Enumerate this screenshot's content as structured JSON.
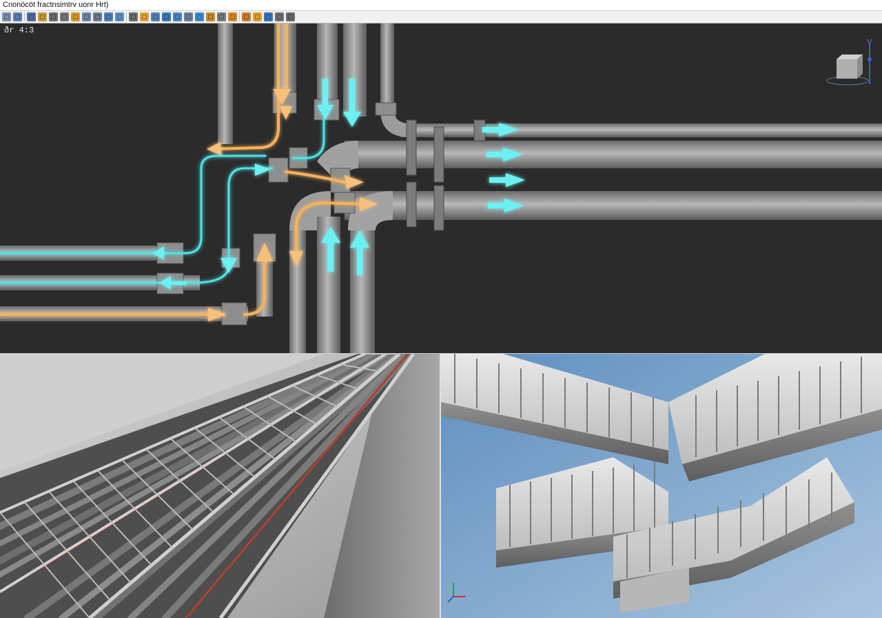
{
  "window": {
    "title": "Cnonócöt fractnsimtrv uonr Hrt)"
  },
  "toolbar": {
    "icons": [
      {
        "name": "frame-icon",
        "color": "#7a8fb0"
      },
      {
        "name": "grid-icon",
        "color": "#5a7fb5"
      },
      {
        "name": "layers-icon",
        "color": "#4d6e9e"
      },
      {
        "name": "cube-icon",
        "color": "#c99a3b"
      },
      {
        "name": "panel-icon",
        "color": "#6d6d6d"
      },
      {
        "name": "loop-icon",
        "color": "#777777"
      },
      {
        "name": "folder-icon",
        "color": "#d6962f"
      },
      {
        "name": "table-icon",
        "color": "#6d86a8"
      },
      {
        "name": "split-icon",
        "color": "#6b7c94"
      },
      {
        "name": "pipe-icon",
        "color": "#4f7fb9"
      },
      {
        "name": "duct-icon",
        "color": "#5d8fc4"
      },
      {
        "name": "tray-icon",
        "color": "#6c6c6c"
      },
      {
        "name": "valve-icon",
        "color": "#e0a33a"
      },
      {
        "name": "fitting-icon",
        "color": "#5580b8"
      },
      {
        "name": "elbow-icon",
        "color": "#3c76b5"
      },
      {
        "name": "tee-icon",
        "color": "#4a84c2"
      },
      {
        "name": "flange-icon",
        "color": "#6e7f94"
      },
      {
        "name": "flow-icon",
        "color": "#3d8fd0"
      },
      {
        "name": "measure-icon",
        "color": "#c68a2a"
      },
      {
        "name": "section-icon",
        "color": "#7a7a7a"
      },
      {
        "name": "render-icon",
        "color": "#d28c2c"
      },
      {
        "name": "tag-icon",
        "color": "#d07a2e"
      },
      {
        "name": "paint-icon",
        "color": "#e0a02f"
      },
      {
        "name": "visibility-icon",
        "color": "#3a74b8"
      },
      {
        "name": "calc-icon",
        "color": "#707070"
      },
      {
        "name": "window-icon",
        "color": "#6a6a6a"
      }
    ]
  },
  "viewport_top": {
    "label": "ðr 4:3",
    "background": "#2b2b2b",
    "hot_color": "#f4b25b",
    "cold_color": "#4fe2e6",
    "pipe_color": "#9a9a9a",
    "view_cube_axis_label": "V"
  },
  "viewport_bottom_left": {
    "subject": "cable tray"
  },
  "viewport_bottom_right": {
    "subject": "ductwork"
  }
}
